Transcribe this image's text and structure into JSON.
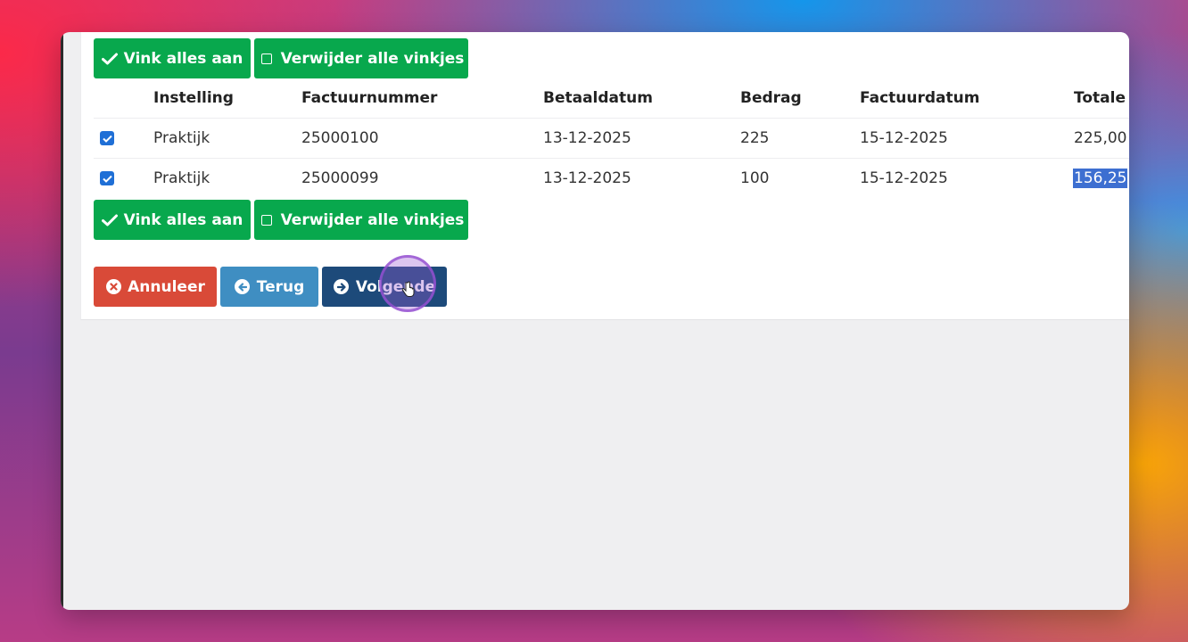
{
  "actions": {
    "check_all": "Vink alles aan",
    "uncheck_all": "Verwijder alle vinkjes"
  },
  "table": {
    "headers": [
      "Instelling",
      "Factuurnummer",
      "Betaaldatum",
      "Bedrag",
      "Factuurdatum",
      "Totale fa"
    ],
    "rows": [
      {
        "checked": true,
        "instelling": "Praktijk",
        "factuurnummer": "25000100",
        "betaaldatum": "13-12-2025",
        "bedrag": "225",
        "factuurdatum": "15-12-2025",
        "totaal": "225,00"
      },
      {
        "checked": true,
        "instelling": "Praktijk",
        "factuurnummer": "25000099",
        "betaaldatum": "13-12-2025",
        "bedrag": "100",
        "factuurdatum": "15-12-2025",
        "totaal": "156,25"
      }
    ]
  },
  "nav": {
    "cancel": "Annuleer",
    "back": "Terug",
    "next": "Volgende"
  },
  "icons": {
    "check_all": "check-icon",
    "uncheck_all": "square-icon",
    "cancel": "x-circle-icon",
    "back": "arrow-left-circle-icon",
    "next": "arrow-right-circle-icon"
  },
  "colors": {
    "green": "#08a84d",
    "red": "#d94a38",
    "blue": "#3f8ec2",
    "navy": "#1d4a7a",
    "checkbox": "#1f6fd6",
    "selection": "#3d6fd1"
  }
}
